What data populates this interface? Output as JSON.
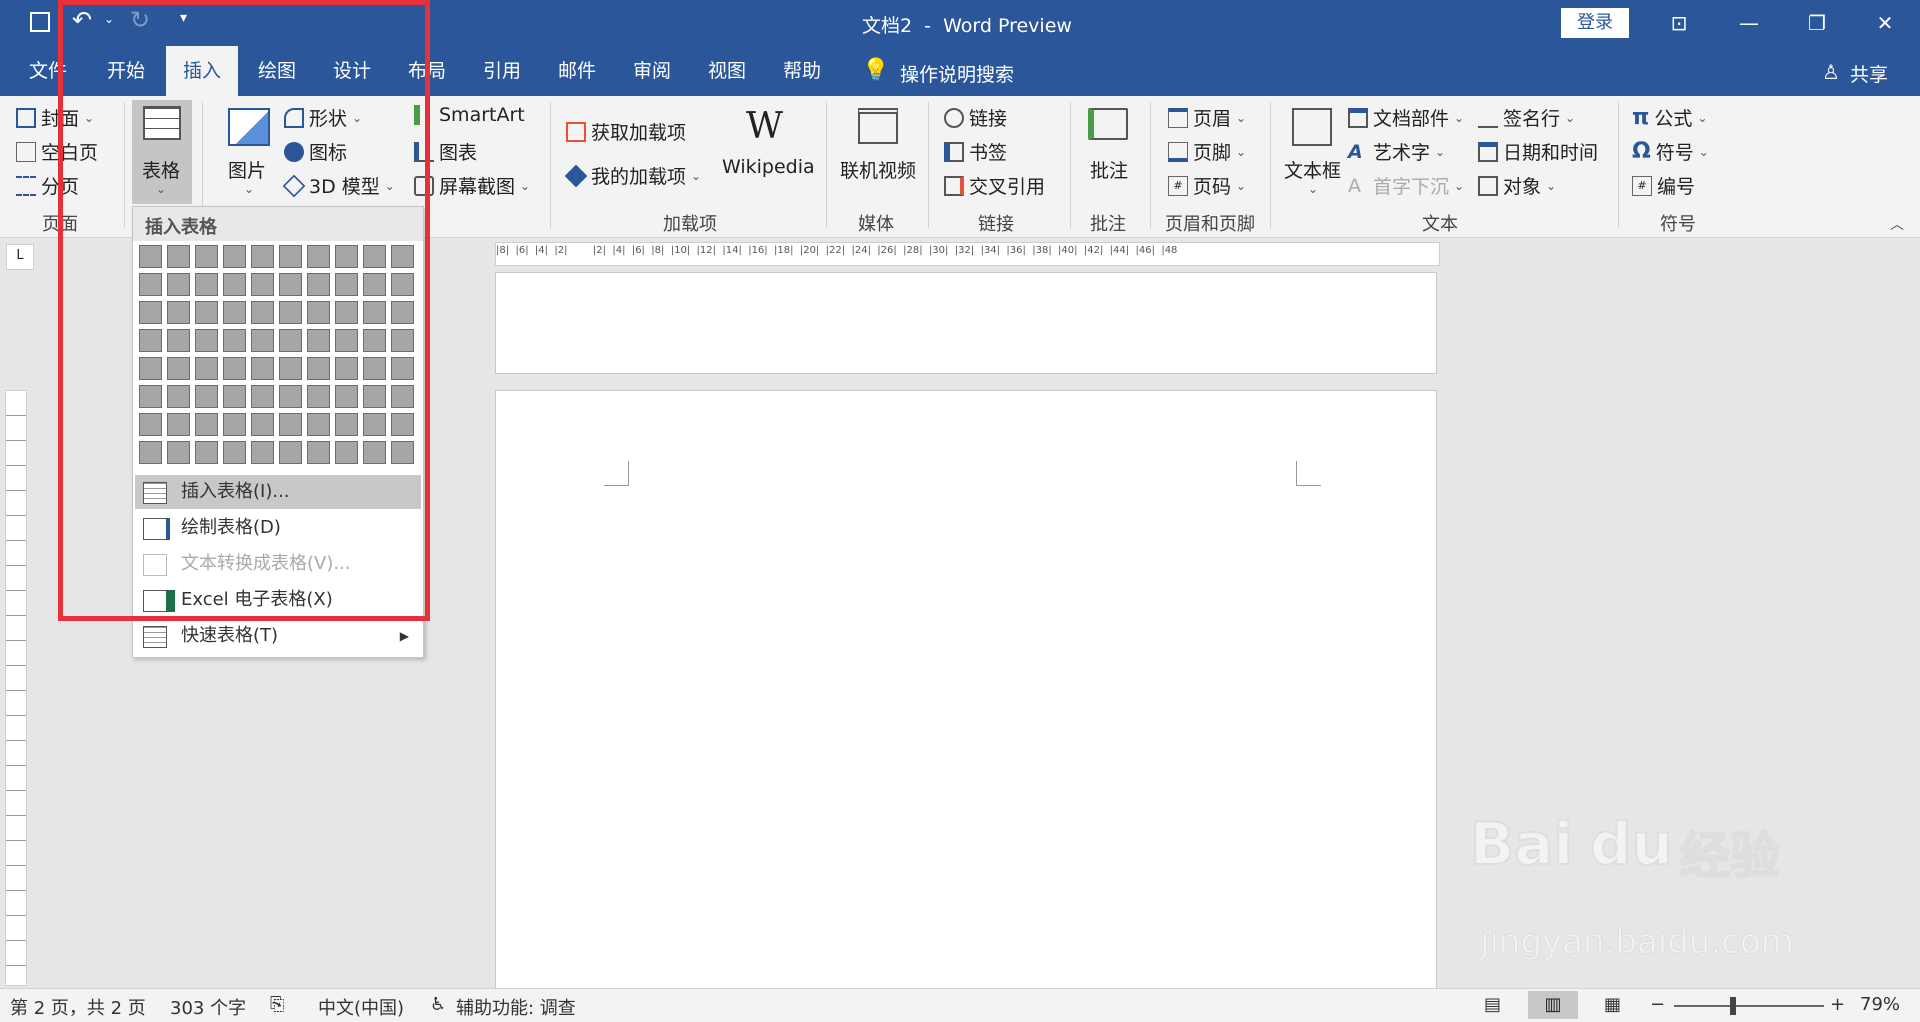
{
  "titlebar": {
    "title": "文档2  -  Word Preview",
    "login": "登录"
  },
  "tabs": [
    "文件",
    "开始",
    "插入",
    "绘图",
    "设计",
    "布局",
    "引用",
    "邮件",
    "审阅",
    "视图",
    "帮助"
  ],
  "active_tab": "插入",
  "tell_me": "操作说明搜索",
  "share": "共享",
  "ribbon": {
    "pages": {
      "cover": "封面",
      "blank": "空白页",
      "break": "分页",
      "label": "页面"
    },
    "table": {
      "label": "表格"
    },
    "illustrations": {
      "picture": "图片",
      "shapes": "形状",
      "icons": "图标",
      "model3d": "3D 模型",
      "smartart": "SmartArt",
      "chart": "图表",
      "screenshot": "屏幕截图"
    },
    "addins": {
      "get": "获取加载项",
      "my": "我的加载项",
      "wiki": "Wikipedia",
      "label": "加载项"
    },
    "media": {
      "video": "联机视频",
      "label": "媒体"
    },
    "links": {
      "link": "链接",
      "bookmark": "书签",
      "crossref": "交叉引用",
      "label": "链接"
    },
    "comments": {
      "comment": "批注",
      "label": "批注"
    },
    "headerfooter": {
      "header": "页眉",
      "footer": "页脚",
      "pagenum": "页码",
      "label": "页眉和页脚"
    },
    "text": {
      "textbox": "文本框",
      "quickparts": "文档部件",
      "wordart": "艺术字",
      "dropcap": "首字下沉",
      "sigline": "签名行",
      "datetime": "日期和时间",
      "object": "对象",
      "label": "文本"
    },
    "symbols": {
      "equation": "公式",
      "symbol": "符号",
      "number": "编号",
      "label": "符号"
    }
  },
  "dropdown": {
    "header": "插入表格",
    "grid": {
      "cols": 10,
      "rows": 8
    },
    "items": [
      {
        "label": "插入表格(I)...",
        "state": "hover"
      },
      {
        "label": "绘制表格(D)",
        "state": "normal"
      },
      {
        "label": "文本转换成表格(V)...",
        "state": "disabled"
      },
      {
        "label": "Excel 电子表格(X)",
        "state": "normal"
      },
      {
        "label": "快速表格(T)",
        "state": "normal",
        "submenu": true
      }
    ]
  },
  "ruler_labels": "|8|  |6|  |4|  |2|        |2|  |4|  |6|  |8|  |10|  |12|  |14|  |16|  |18|  |20|  |22|  |24|  |26|  |28|  |30|  |32|  |34|  |36|  |38|  |40|  |42|  |44|  |46|  |48",
  "status": {
    "page": "第 2 页，共 2 页",
    "words": "303 个字",
    "lang": "中文(中国)",
    "access": "辅助功能: 调查",
    "zoom": "79%"
  },
  "colors": {
    "brand": "#2b579a",
    "highlight": "#e8303a"
  },
  "watermark": {
    "brand": "Baidu经验",
    "url": "jingyan.baidu.com"
  }
}
